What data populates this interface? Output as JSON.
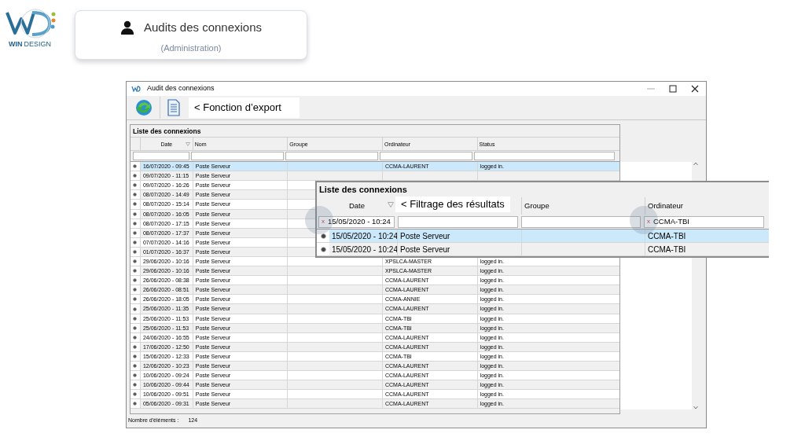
{
  "logo": {
    "brand_bold": "WIN",
    "brand_light": "DESIGN"
  },
  "title_card": {
    "title": "Audits des connexions",
    "subtitle": "(Administration)"
  },
  "window": {
    "title": "Audit des connexions",
    "toolbar_note": "< Fonction d’export",
    "grid": {
      "caption": "Liste des connexions",
      "columns": [
        "Date",
        "Nom",
        "Groupe",
        "Ordinateur",
        "Status"
      ],
      "rows": [
        {
          "date": "16/07/2020 - 09:45",
          "name": "Poste Serveur",
          "computer": "CCMA-LAURENT",
          "status": "logged in.",
          "selected": true
        },
        {
          "date": "09/07/2020 - 11:15",
          "name": "Poste Serveur",
          "selected": false
        },
        {
          "date": "09/07/2020 - 16:26",
          "name": "Poste Serveur",
          "selected": false
        },
        {
          "date": "08/07/2020 - 14:49",
          "name": "Poste Serveur",
          "selected": false
        },
        {
          "date": "08/07/2020 - 15:14",
          "name": "Poste Serveur",
          "selected": false
        },
        {
          "date": "08/07/2020 - 16:05",
          "name": "Poste Serveur",
          "selected": false
        },
        {
          "date": "08/07/2020 - 17:15",
          "name": "Poste Serveur",
          "selected": false
        },
        {
          "date": "08/07/2020 - 17:37",
          "name": "Poste Serveur",
          "selected": false
        },
        {
          "date": "07/07/2020 - 14:16",
          "name": "Poste Serveur",
          "selected": false
        },
        {
          "date": "01/07/2020 - 16:37",
          "name": "Poste Serveur",
          "selected": false
        },
        {
          "date": "29/06/2020 - 10:16",
          "name": "Poste Serveur",
          "computer": "XPSLCA-MASTER",
          "status": "logged in.",
          "selected": false
        },
        {
          "date": "29/06/2020 - 10:16",
          "name": "Poste Serveur",
          "computer": "XPSLCA-MASTER",
          "status": "logged in.",
          "selected": false
        },
        {
          "date": "26/06/2020 - 08:38",
          "name": "Poste Serveur",
          "computer": "CCMA-LAURENT",
          "status": "logged in.",
          "selected": false
        },
        {
          "date": "26/06/2020 - 08:51",
          "name": "Poste Serveur",
          "computer": "CCMA-LAURENT",
          "status": "logged in.",
          "selected": false
        },
        {
          "date": "26/06/2020 - 18:05",
          "name": "Poste Serveur",
          "computer": "CCMA-ANNIE",
          "status": "logged in.",
          "selected": false
        },
        {
          "date": "25/06/2020 - 11:35",
          "name": "Poste Serveur",
          "computer": "CCMA-LAURENT",
          "status": "logged in.",
          "selected": false
        },
        {
          "date": "25/06/2020 - 11:53",
          "name": "Poste Serveur",
          "computer": "CCMA-TBI",
          "status": "logged in.",
          "selected": false
        },
        {
          "date": "25/06/2020 - 11:53",
          "name": "Poste Serveur",
          "computer": "CCMA-TBI",
          "status": "logged in.",
          "selected": false
        },
        {
          "date": "24/06/2020 - 16:55",
          "name": "Poste Serveur",
          "computer": "CCMA-LAURENT",
          "status": "logged in.",
          "selected": false
        },
        {
          "date": "17/06/2020 - 12:50",
          "name": "Poste Serveur",
          "computer": "CCMA-LAURENT",
          "status": "logged in.",
          "selected": false
        },
        {
          "date": "15/06/2020 - 12:33",
          "name": "Poste Serveur",
          "computer": "CCMA-TBI",
          "status": "logged in.",
          "selected": false
        },
        {
          "date": "12/06/2020 - 10:23",
          "name": "Poste Serveur",
          "computer": "CCMA-LAURENT",
          "status": "logged in.",
          "selected": false
        },
        {
          "date": "10/06/2020 - 09:24",
          "name": "Poste Serveur",
          "computer": "CCMA-LAURENT",
          "status": "logged in.",
          "selected": false
        },
        {
          "date": "10/06/2020 - 09:44",
          "name": "Poste Serveur",
          "computer": "CCMA-LAURENT",
          "status": "logged in.",
          "selected": false
        },
        {
          "date": "10/06/2020 - 09:51",
          "name": "Poste Serveur",
          "computer": "CCMA-LAURENT",
          "status": "logged in.",
          "selected": false
        },
        {
          "date": "05/06/2020 - 09:31",
          "name": "Poste Serveur",
          "computer": "CCMA-LAURENT",
          "status": "logged in.",
          "selected": false
        }
      ]
    },
    "status_bar": {
      "label": "Nombre d'éléments :",
      "count": "124"
    }
  },
  "filter_zoom": {
    "caption": "Liste des connexions",
    "columns": [
      "Date",
      "Groupe",
      "Ordinateur"
    ],
    "note": "< Filtrage des résultats",
    "filters": {
      "date": {
        "clear": "x",
        "value": "15/05/2020 - 10:24"
      },
      "computer": {
        "clear": "x",
        "value": "CCMA-TBI"
      }
    },
    "rows": [
      {
        "date": "15/05/2020 - 10:24",
        "name": "Poste Serveur",
        "computer": "CCMA-TBI",
        "selected": true
      },
      {
        "date": "15/05/2020 - 10:24",
        "name": "Poste Serveur",
        "computer": "CCMA-TBI",
        "selected": false
      }
    ]
  }
}
